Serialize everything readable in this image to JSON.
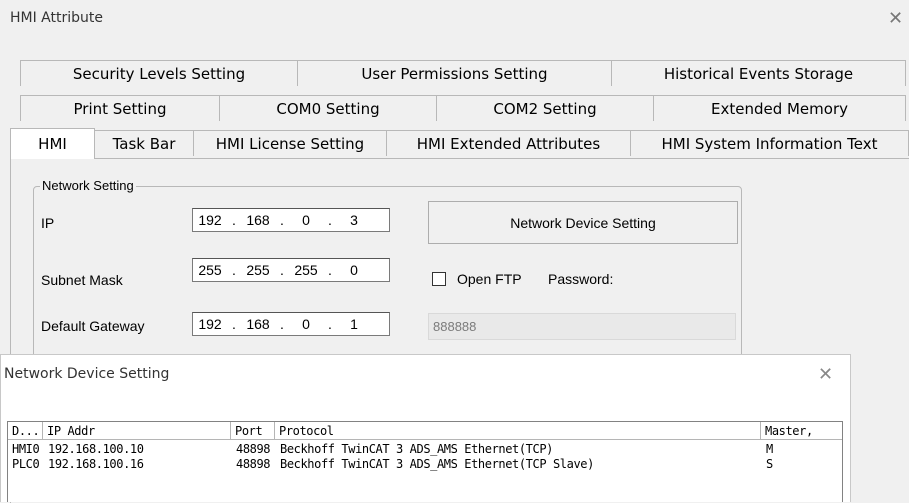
{
  "main_dialog": {
    "title": "HMI Attribute",
    "close_icon": "close-icon"
  },
  "tabs": {
    "row1": [
      "Security Levels Setting",
      "User Permissions Setting",
      "Historical Events Storage"
    ],
    "row2": [
      "Print Setting",
      "COM0 Setting",
      "COM2 Setting",
      "Extended Memory"
    ],
    "row3": [
      "HMI",
      "Task Bar",
      "HMI License Setting",
      "HMI Extended Attributes",
      "HMI System Information Text"
    ]
  },
  "network": {
    "group_label": "Network Setting",
    "ip_label": "IP",
    "ip": [
      "192",
      "168",
      "0",
      "3"
    ],
    "subnet_label": "Subnet Mask",
    "subnet": [
      "255",
      "255",
      "255",
      "0"
    ],
    "gateway_label": "Default Gateway",
    "gateway": [
      "192",
      "168",
      "0",
      "1"
    ],
    "device_button": "Network Device Setting",
    "ftp_label": "Open FTP",
    "password_label": "Password:",
    "password_value": "888888"
  },
  "device_dialog": {
    "title": "Network Device Setting",
    "columns": [
      "D...",
      "IP Addr",
      "Port",
      "Protocol",
      "Master,"
    ],
    "rows": [
      [
        "HMI0",
        "192.168.100.10",
        "48898",
        "Beckhoff TwinCAT 3 ADS_AMS Ethernet(TCP)",
        "M"
      ],
      [
        "PLC0",
        "192.168.100.16",
        "48898",
        "Beckhoff TwinCAT 3 ADS_AMS Ethernet(TCP Slave)",
        "S"
      ]
    ]
  }
}
